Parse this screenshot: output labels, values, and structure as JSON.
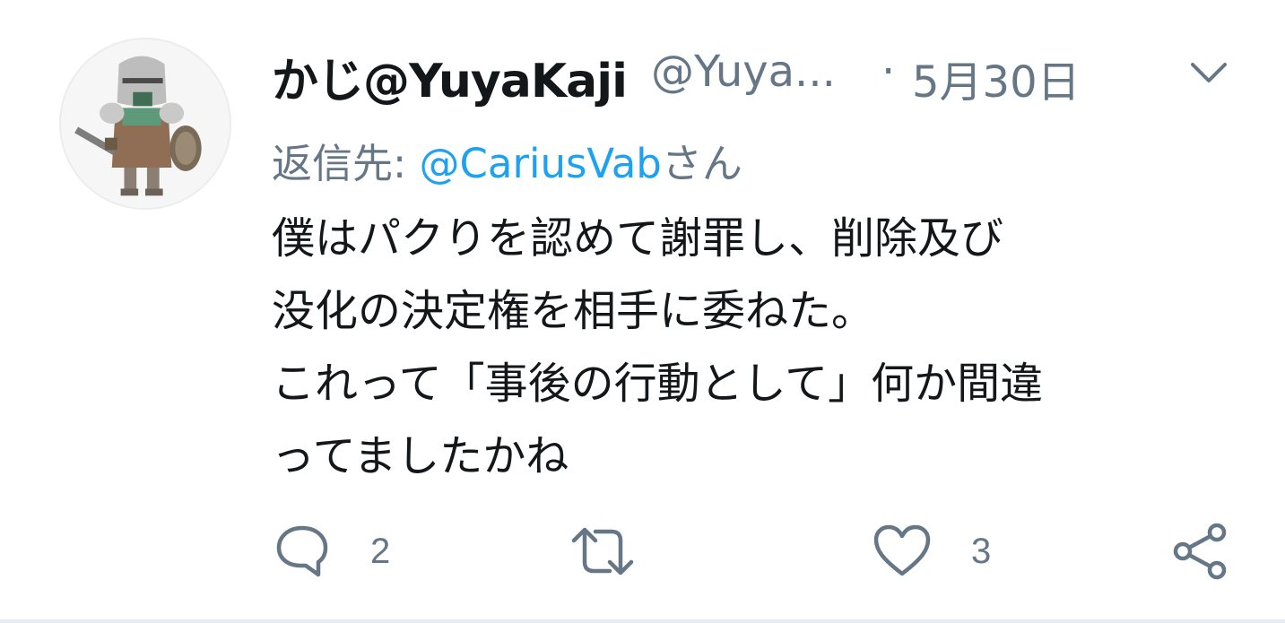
{
  "tweet": {
    "display_name": "かじ@YuyaKaji",
    "handle": "@Yuya...",
    "separator": "·",
    "date": "5月30日",
    "reply_prefix": "返信先: ",
    "reply_mention": "@CariusVab",
    "reply_suffix": "さん",
    "text": "僕はパクりを認めて謝罪し、削除及び\n没化の決定権を相手に委ねた。\nこれって「事後の行動として」何か間違\nってましたかね"
  },
  "actions": {
    "reply_count": "2",
    "retweet_count": "",
    "like_count": "3"
  },
  "colors": {
    "text": "#14171a",
    "secondary": "#657786",
    "link": "#1da1f2",
    "divider": "#e6ecf0"
  },
  "icons": [
    "knight-avatar",
    "chevron-down-icon",
    "reply-icon",
    "retweet-icon",
    "heart-icon",
    "share-icon"
  ]
}
